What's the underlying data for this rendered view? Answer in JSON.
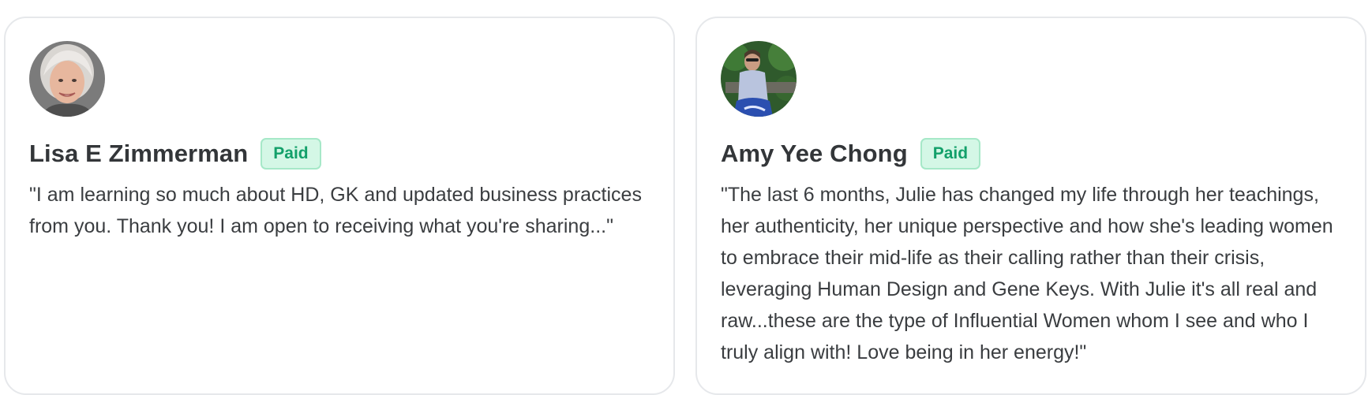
{
  "testimonials": [
    {
      "name": "Lisa E Zimmerman",
      "badge": "Paid",
      "quote": "\"I am learning so much about HD, GK and updated business practices from you. Thank you! I am open to receiving what you're sharing...\""
    },
    {
      "name": "Amy Yee Chong",
      "badge": "Paid",
      "quote": "\"The last 6 months, Julie has changed my life through her teachings, her authenticity, her unique perspective and how she's leading women to embrace their mid-life as their calling rather than their crisis, leveraging Human Design and Gene Keys. With Julie it's all real and raw...these are the type of Influential Women whom I see and who I truly align with! Love being in her energy!\""
    }
  ],
  "colors": {
    "badge_bg": "#d4f7e6",
    "badge_text": "#13a06a",
    "card_border": "#e6e8eb"
  }
}
